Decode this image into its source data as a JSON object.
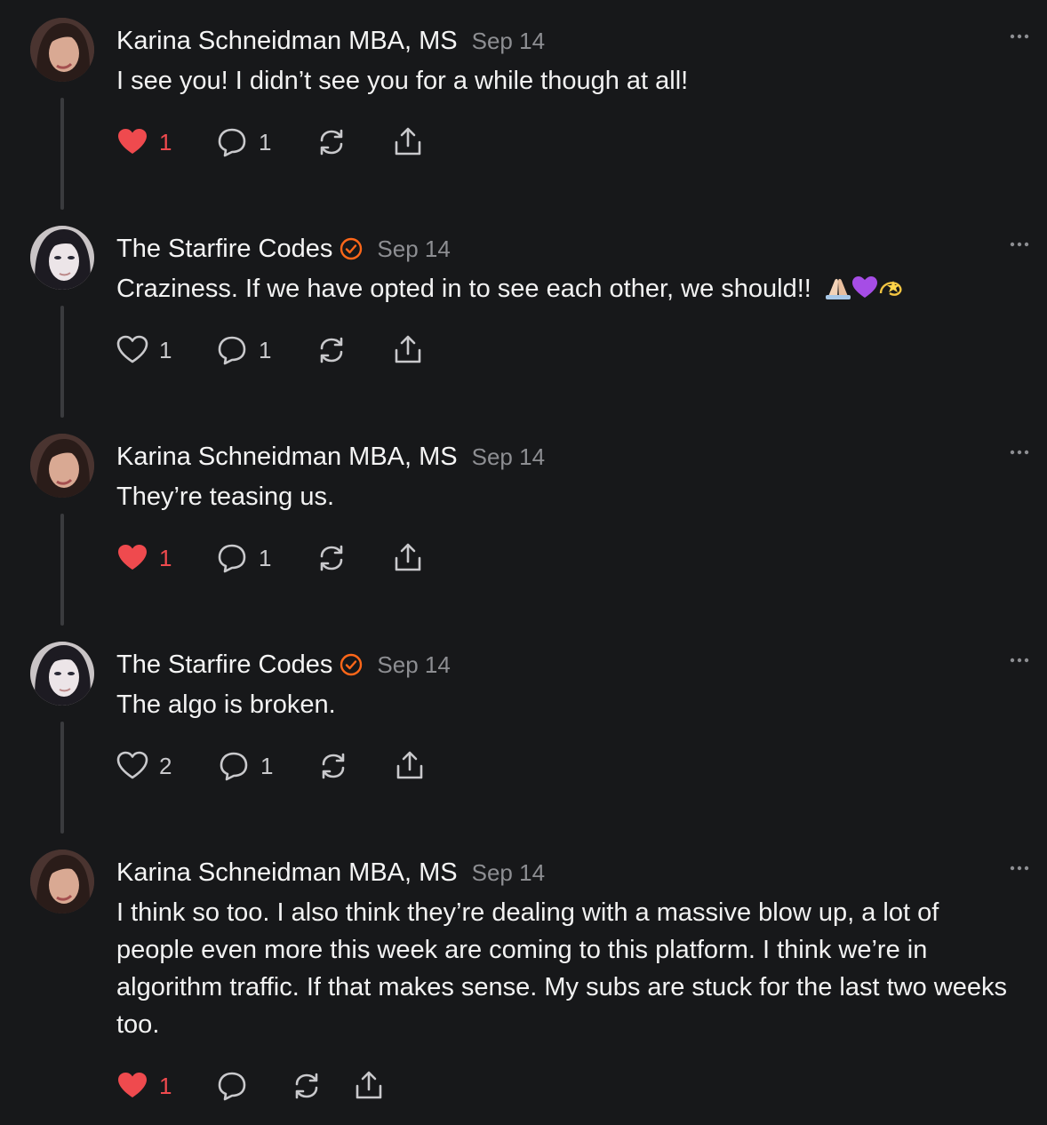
{
  "comments": [
    {
      "author": "Karina Schneidman MBA, MS",
      "verified": false,
      "date": "Sep 14",
      "body": "I see you! I didn’t see you for a while though at all!",
      "liked": true,
      "likes": "1",
      "replies": "1",
      "avatar": "karina-avatar"
    },
    {
      "author": "The Starfire Codes",
      "verified": true,
      "date": "Sep 14",
      "body": "Craziness. If we have opted in to see each other, we should!!",
      "emoji": "🙏🏻💜💫",
      "liked": false,
      "likes": "1",
      "replies": "1",
      "avatar": "starfire-avatar"
    },
    {
      "author": "Karina Schneidman MBA, MS",
      "verified": false,
      "date": "Sep 14",
      "body": "They’re teasing us.",
      "liked": true,
      "likes": "1",
      "replies": "1",
      "avatar": "karina-avatar"
    },
    {
      "author": "The Starfire Codes",
      "verified": true,
      "date": "Sep 14",
      "body": "The algo is broken.",
      "liked": false,
      "likes": "2",
      "replies": "1",
      "avatar": "starfire-avatar"
    },
    {
      "author": "Karina Schneidman MBA, MS",
      "verified": false,
      "date": "Sep 14",
      "body": "I think so too. I also think they’re dealing with a massive blow up, a lot of people even more this week are coming to this platform. I think we’re in algorithm traffic. If that makes sense. My subs are stuck for the last two weeks too.",
      "liked": true,
      "likes": "1",
      "replies": "",
      "avatar": "karina-avatar"
    }
  ],
  "colors": {
    "background": "#17181a",
    "liked_heart": "#ef4a4e",
    "verified_badge": "#ff6719",
    "muted_text": "#8d8e92"
  },
  "icons": {
    "like": "heart-icon",
    "reply": "comment-bubble-icon",
    "restack": "restack-icon",
    "share": "share-icon",
    "more": "more-options-icon",
    "verified": "verified-badge-icon"
  }
}
